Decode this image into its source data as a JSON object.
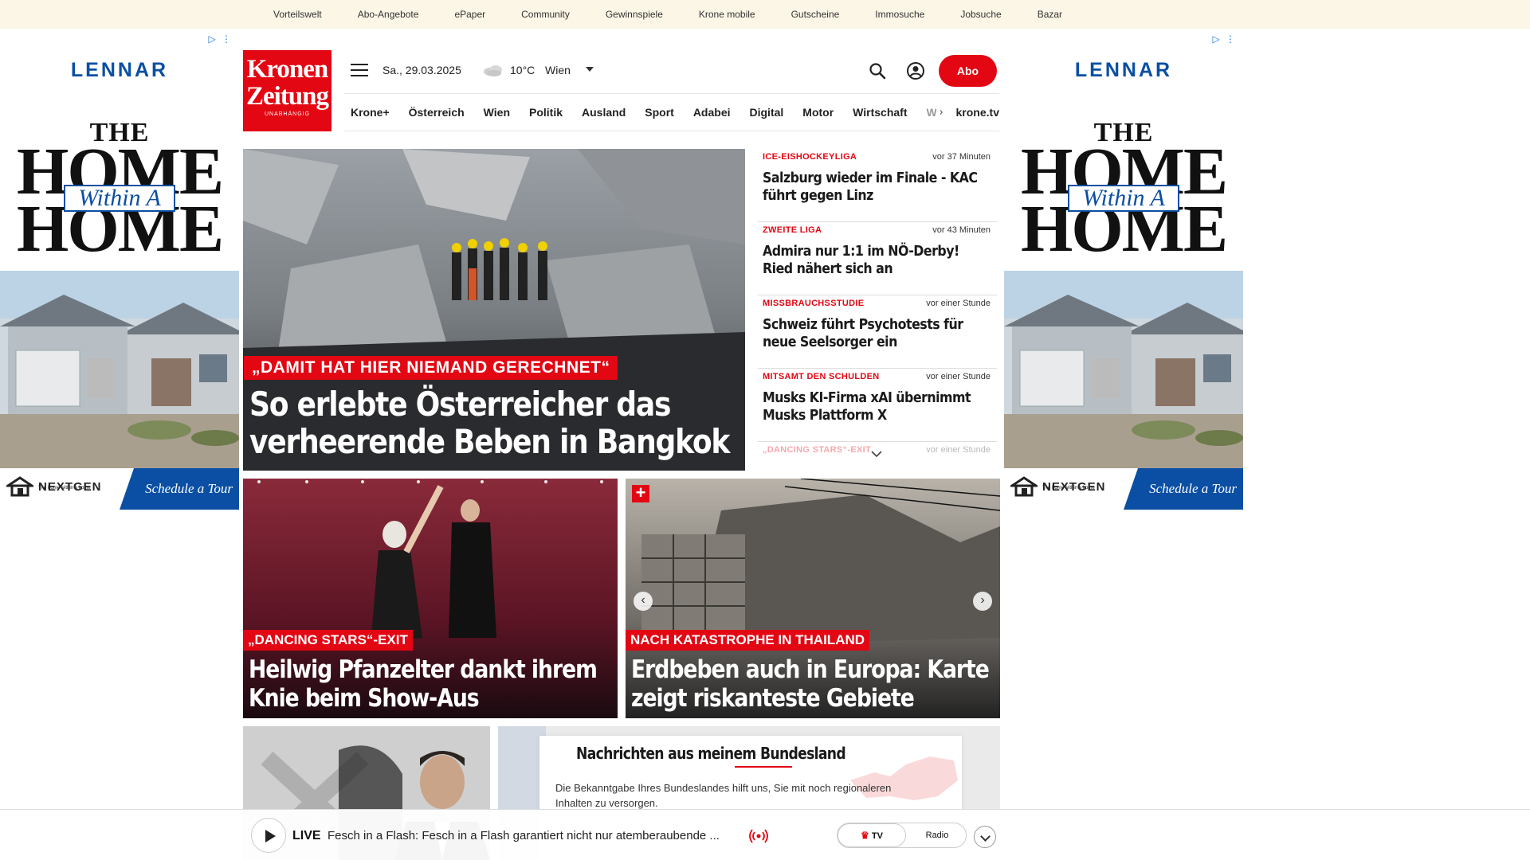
{
  "topbar": {
    "links": [
      "Vorteilswelt",
      "Abo-Angebote",
      "ePaper",
      "Community",
      "Gewinnspiele",
      "Krone mobile",
      "Gutscheine",
      "Immosuche",
      "Jobsuche",
      "Bazar"
    ]
  },
  "ads": {
    "choices": "▷ ⋮",
    "brand": "LENNAR",
    "the": "THE",
    "home": "HOME",
    "within": "Within A",
    "footer_brand": "NEXTGEN",
    "footer_tag": "The home within a home",
    "cta": "Schedule a Tour"
  },
  "header": {
    "logo_line1": "Kronen",
    "logo_line2": "Zeitung",
    "logo_line3": "UNABHÄNGIG",
    "date": "Sa., 29.03.2025",
    "temperature": "10°C",
    "city": "Wien",
    "abo_label": "Abo"
  },
  "nav": {
    "items": [
      "Krone+",
      "Österreich",
      "Wien",
      "Politik",
      "Ausland",
      "Sport",
      "Adabei",
      "Digital",
      "Motor",
      "Wirtschaft"
    ],
    "truncated": "Wiss",
    "tv": "krone.tv"
  },
  "hero": {
    "kicker": "„DAMIT HAT HIER NIEMAND GERECHNET“",
    "title": "So erlebte Österreicher das verheerende Beben in Bangkok"
  },
  "newslist": [
    {
      "kicker": "ICE-EISHOCKEYLIGA",
      "time": "vor 37 Minuten",
      "title": "Salzburg wieder im Finale - KAC führt gegen Linz"
    },
    {
      "kicker": "ZWEITE LIGA",
      "time": "vor 43 Minuten",
      "title": "Admira nur 1:1 im NÖ-Derby! Ried nähert sich an"
    },
    {
      "kicker": "MISSBRAUCHSSTUDIE",
      "time": "vor einer Stunde",
      "title": "Schweiz führt Psychotests für neue Seelsorger ein"
    },
    {
      "kicker": "MITSAMT DEN SCHULDEN",
      "time": "vor einer Stunde",
      "title": "Musks KI-Firma xAI übernimmt Musks Plattform X"
    },
    {
      "kicker": "„DANCING STARS“-EXIT",
      "time": "vor einer Stunde",
      "title": ""
    }
  ],
  "cards": [
    {
      "kicker": "„DANCING STARS“-EXIT",
      "title": "Heilwig Pfanzelter dankt ihrem Knie beim Show-Aus"
    },
    {
      "kicker": "NACH KATASTROPHE IN THAILAND",
      "title": "Erdbeben auch in Europa: Karte zeigt riskanteste Gebiete",
      "plus": "+",
      "prev": "‹",
      "next": "›"
    }
  ],
  "bundesland": {
    "title": "Nachrichten aus meinem Bundesland",
    "text": "Die Bekanntgabe Ihres Bundeslandes hilft uns, Sie mit noch regionaleren Inhalten zu versorgen."
  },
  "player": {
    "live": "LIVE",
    "title": "Fesch in a Flash: Fesch in a Flash garantiert nicht nur atemberaubende ...",
    "tv": "TV",
    "radio": "Radio"
  },
  "colors": {
    "brand_red": "#e30613",
    "topbar_bg": "#fbf6e6",
    "ad_blue": "#0a4fa3"
  }
}
